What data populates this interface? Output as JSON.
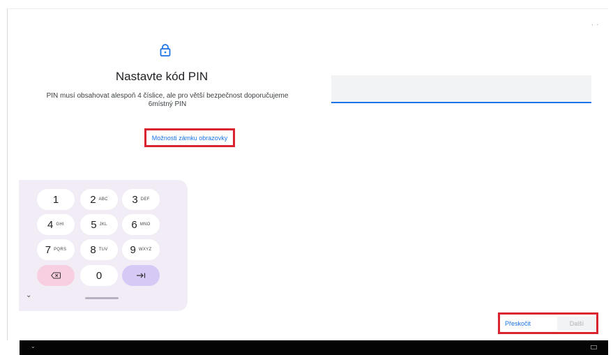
{
  "header": {
    "lock_icon": "lock-icon",
    "title": "Nastavte kód PIN",
    "subtitle_line1": "PIN musí obsahovat alespoň 4 číslice, ale pro větší bezpečnost doporučujeme",
    "subtitle_line2": "6místný PIN",
    "lock_options_link": "Možnosti zámku obrazovky",
    "top_dots": ". ."
  },
  "pin_field": {
    "value": ""
  },
  "keyboard": {
    "keys": [
      {
        "digit": "1",
        "letters": ""
      },
      {
        "digit": "2",
        "letters": "ABC"
      },
      {
        "digit": "3",
        "letters": "DEF"
      },
      {
        "digit": "4",
        "letters": "GHI"
      },
      {
        "digit": "5",
        "letters": "JKL"
      },
      {
        "digit": "6",
        "letters": "MNO"
      },
      {
        "digit": "7",
        "letters": "PQRS"
      },
      {
        "digit": "8",
        "letters": "TUV"
      },
      {
        "digit": "9",
        "letters": "WXYZ"
      },
      {
        "digit": "0",
        "letters": ""
      }
    ],
    "delete_icon": "backspace-icon",
    "next_icon": "tab-next-icon",
    "collapse_icon": "chevron-down-icon"
  },
  "footer": {
    "skip_label": "Přeskočit",
    "next_label": "Další"
  },
  "colors": {
    "accent": "#1a73e8",
    "highlight_box": "#d9232e",
    "keyboard_bg": "#f1ecf6"
  }
}
